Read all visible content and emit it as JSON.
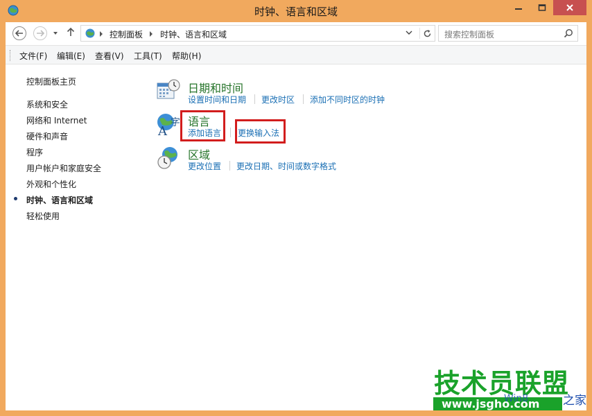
{
  "window": {
    "title": "时钟、语言和区域",
    "icon": "control-panel-icon"
  },
  "address": {
    "breadcrumbs": [
      "控制面板",
      "时钟、语言和区域"
    ],
    "search_placeholder": "搜索控制面板"
  },
  "menu": {
    "items": [
      "文件(F)",
      "编辑(E)",
      "查看(V)",
      "工具(T)",
      "帮助(H)"
    ]
  },
  "sidebar": {
    "home": "控制面板主页",
    "items": [
      {
        "label": "系统和安全",
        "current": false
      },
      {
        "label": "网络和 Internet",
        "current": false
      },
      {
        "label": "硬件和声音",
        "current": false
      },
      {
        "label": "程序",
        "current": false
      },
      {
        "label": "用户帐户和家庭安全",
        "current": false
      },
      {
        "label": "外观和个性化",
        "current": false
      },
      {
        "label": "时钟、语言和区域",
        "current": true
      },
      {
        "label": "轻松使用",
        "current": false
      }
    ]
  },
  "categories": [
    {
      "title": "日期和时间",
      "icon": "calendar-clock-icon",
      "tasks": [
        "设置时间和日期",
        "更改时区",
        "添加不同时区的时钟"
      ]
    },
    {
      "title": "语言",
      "icon": "language-globe-icon",
      "tasks": [
        "添加语言",
        "更换输入法"
      ]
    },
    {
      "title": "区域",
      "icon": "region-globe-clock-icon",
      "tasks": [
        "更改位置",
        "更改日期、时间或数字格式"
      ]
    }
  ],
  "watermark": {
    "title": "技术员联盟",
    "url": "www.jsgho.com",
    "side_text": "之家",
    "faded_text": "Win8"
  },
  "colors": {
    "window_frame": "#f1a95e",
    "link": "#1a6fb4",
    "category_title": "#26742a",
    "highlight_box": "#d21d1d",
    "watermark_green": "#1aa22a"
  }
}
